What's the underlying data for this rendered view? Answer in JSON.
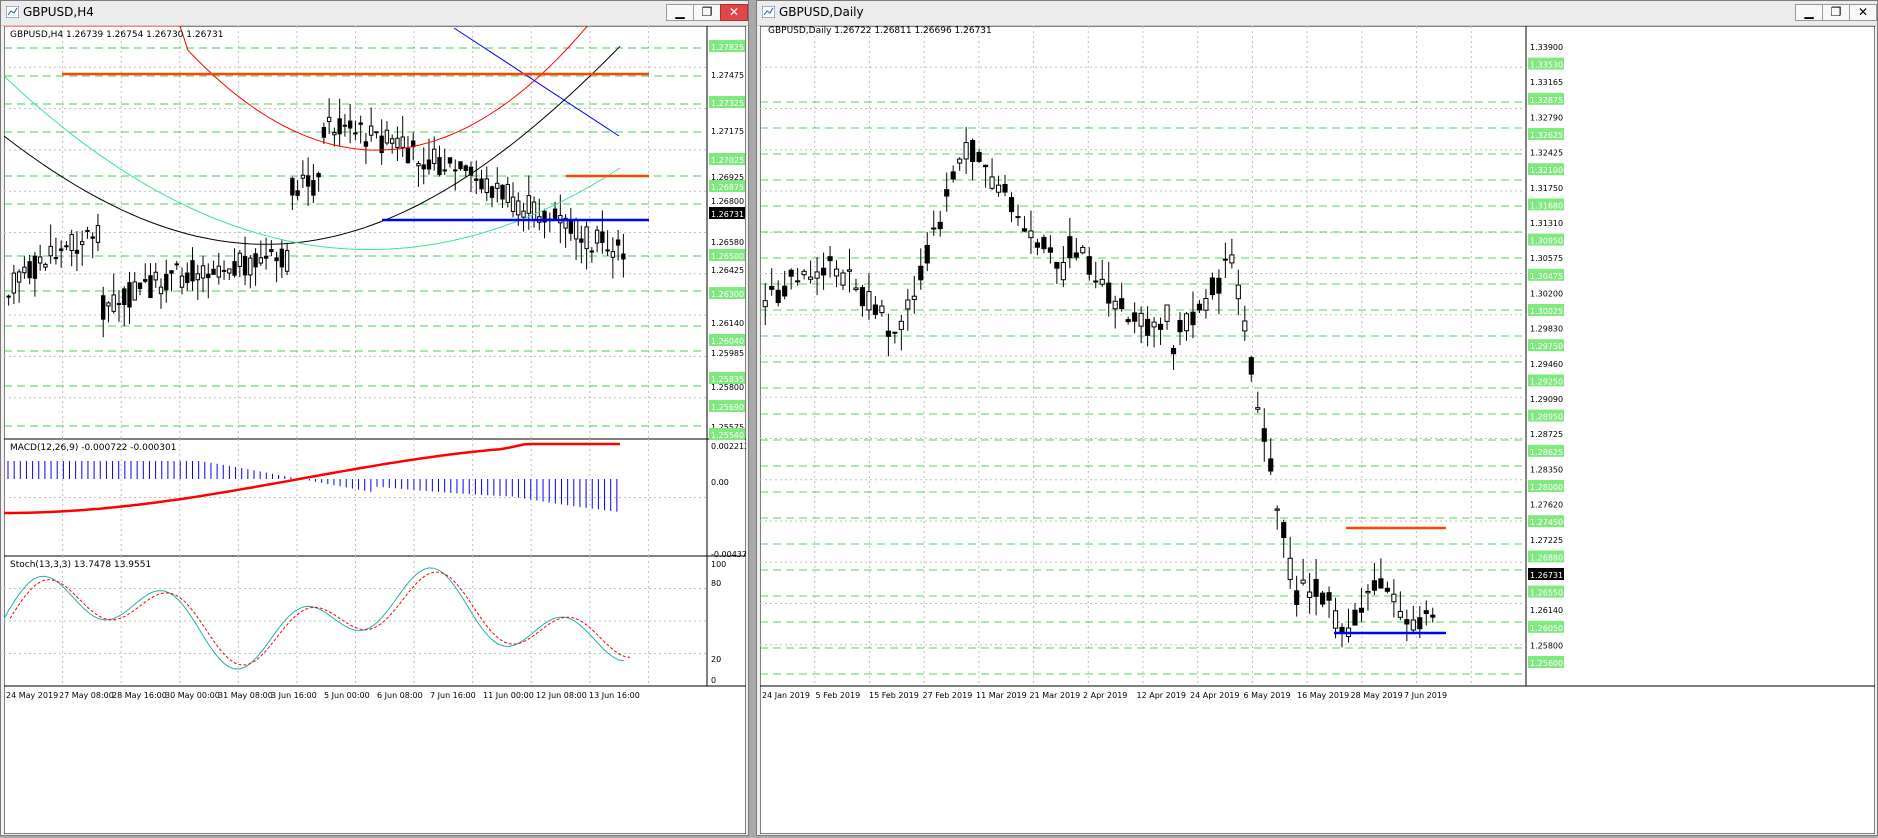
{
  "windows": {
    "h4": {
      "title": "GBPUSD,H4",
      "info": "GBPUSD,H4  1.26739 1.26754 1.26730 1.26731",
      "price_labels": [
        "1.27825",
        "1.27475",
        "1.27325",
        "1.27175",
        "1.27025",
        "1.26925",
        "1.26875",
        "1.26800",
        "1.26731",
        "1.26580",
        "1.26500",
        "1.26425",
        "1.26300",
        "1.26140",
        "1.26040",
        "1.25985",
        "1.25835",
        "1.25800",
        "1.25690",
        "1.25575",
        "1.25540"
      ],
      "time_labels": [
        "24 May 2019",
        "27 May 08:00",
        "28 May 16:00",
        "30 May 00:00",
        "31 May 08:00",
        "3 Jun 16:00",
        "5 Jun 00:00",
        "6 Jun 08:00",
        "7 Jun 16:00",
        "11 Jun 00:00",
        "12 Jun 08:00",
        "13 Jun 16:00"
      ],
      "macd": {
        "label": "MACD(12,26,9) -0.000722 -0.000301",
        "scale": [
          "0.002212",
          "0.00",
          "-0.004372"
        ]
      },
      "stoch": {
        "label": "Stoch(13,3,3) 13.7478 13.9551",
        "scale": [
          "100",
          "80",
          "20",
          "0"
        ]
      }
    },
    "daily": {
      "title": "GBPUSD,Daily",
      "info": "GBPUSD,Daily  1.26722 1.26811 1.26696 1.26731",
      "price_labels": [
        "1.33900",
        "1.33530",
        "1.33165",
        "1.32875",
        "1.32790",
        "1.32625",
        "1.32425",
        "1.32100",
        "1.31750",
        "1.31680",
        "1.31310",
        "1.30950",
        "1.30575",
        "1.30475",
        "1.30200",
        "1.30025",
        "1.29830",
        "1.29750",
        "1.29460",
        "1.29250",
        "1.29090",
        "1.28950",
        "1.28725",
        "1.28625",
        "1.28350",
        "1.28000",
        "1.27620",
        "1.27450",
        "1.27225",
        "1.26880",
        "1.26731",
        "1.26550",
        "1.26140",
        "1.26050",
        "1.25800",
        "1.25600"
      ],
      "time_labels": [
        "24 Jan 2019",
        "5 Feb 2019",
        "15 Feb 2019",
        "27 Feb 2019",
        "11 Mar 2019",
        "21 Mar 2019",
        "2 Apr 2019",
        "12 Apr 2019",
        "24 Apr 2019",
        "6 May 2019",
        "16 May 2019",
        "28 May 2019",
        "7 Jun 2019"
      ]
    }
  },
  "colors": {
    "resistance": "#ff4500",
    "support": "#0000ff",
    "ma_black": "#000000",
    "ma_red": "#ff0000",
    "ma_green": "#40e0a0",
    "ma_blue": "#0000ff",
    "stoch_main": "#20b2aa",
    "stoch_signal": "#ff0000",
    "grid": "#00c000",
    "level_box": "#7fe87f"
  }
}
